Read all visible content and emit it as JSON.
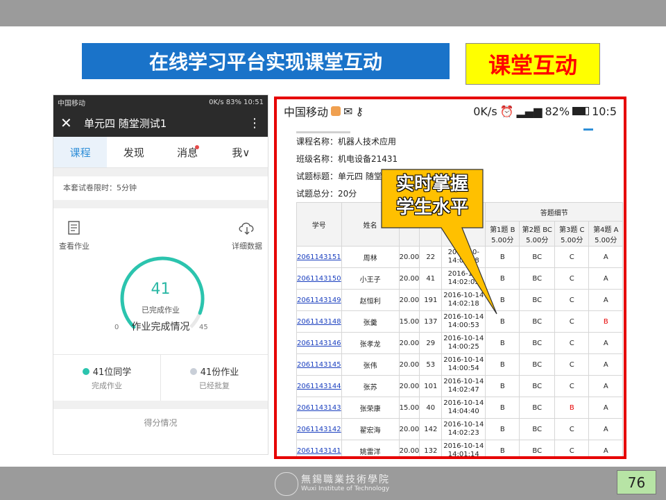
{
  "slide": {
    "title": "在线学习平台实现课堂互动",
    "tag": "课堂互动",
    "page_number": "76",
    "footer_cn": "無錫職業技術學院",
    "footer_en": "Wuxi Institute of Technology"
  },
  "left_phone": {
    "status_left": "中国移动",
    "status_right": "0K/s 83% 10:51",
    "nav_title": "单元四 随堂测试1",
    "tabs": [
      {
        "label": "课程",
        "active": true
      },
      {
        "label": "发现",
        "active": false
      },
      {
        "label": "消息",
        "active": false,
        "badge": true
      },
      {
        "label": "我∨",
        "active": false
      }
    ],
    "time_limit": "本套试卷限时：5分钟",
    "view_homework": "查看作业",
    "detail_data": "详细数据",
    "gauge": {
      "value": "41",
      "label": "已完成作业",
      "caption": "作业完成情况",
      "min": "0",
      "max": "45",
      "fraction": 0.911
    },
    "stats": [
      {
        "big": "41位同学",
        "small": "完成作业",
        "color": "#2bc4ae"
      },
      {
        "big": "41份作业",
        "small": "已经批复",
        "color": "#c9cfd8"
      }
    ],
    "score_label": "得分情况"
  },
  "right_shot": {
    "status_left": "中国移动",
    "status_right": "0K/s",
    "battery": "82%",
    "time": "10:5",
    "course_name": "课程名称：机器人技术应用",
    "class_name": "班级名称：机电设备21431",
    "test_title": "试题标题：单元四 随堂",
    "total_score": "试题总分：20分",
    "headers": {
      "sid": "学号",
      "name": "姓名",
      "detail": "答题细节",
      "q1": "第1题 B",
      "q1s": "5.00分",
      "q2": "第2题 BC",
      "q2s": "5.00分",
      "q3": "第3题 C",
      "q3s": "5.00分",
      "q4": "第4题 A",
      "q4s": "5.00分"
    },
    "rows": [
      {
        "sid": "2061143151",
        "name": "周林",
        "score": "20.00",
        "sec": "22",
        "d": "2016-10-",
        "t": "14:02:08",
        "a1": "B",
        "a2": "BC",
        "a3": "C",
        "a4": "A"
      },
      {
        "sid": "2061143150",
        "name": "小王子",
        "score": "20.00",
        "sec": "41",
        "d": "2016-10-",
        "t": "14:02:05",
        "a1": "B",
        "a2": "BC",
        "a3": "C",
        "a4": "A"
      },
      {
        "sid": "2061143149",
        "name": "赵恒利",
        "score": "20.00",
        "sec": "191",
        "d": "2016-10-14",
        "t": "14:02:18",
        "a1": "B",
        "a2": "BC",
        "a3": "C",
        "a4": "A"
      },
      {
        "sid": "2061143148",
        "name": "张羹",
        "score": "15.00",
        "sec": "137",
        "d": "2016-10-14",
        "t": "14:00:53",
        "a1": "B",
        "a2": "BC",
        "a3": "C",
        "a4": "B",
        "a4red": true
      },
      {
        "sid": "2061143146",
        "name": "张孝龙",
        "score": "20.00",
        "sec": "29",
        "d": "2016-10-14",
        "t": "14:00:25",
        "a1": "B",
        "a2": "BC",
        "a3": "C",
        "a4": "A"
      },
      {
        "sid": "2061143145",
        "name": "张伟",
        "score": "20.00",
        "sec": "53",
        "d": "2016-10-14",
        "t": "14:00:54",
        "a1": "B",
        "a2": "BC",
        "a3": "C",
        "a4": "A"
      },
      {
        "sid": "2061143144",
        "name": "张苏",
        "score": "20.00",
        "sec": "101",
        "d": "2016-10-14",
        "t": "14:02:47",
        "a1": "B",
        "a2": "BC",
        "a3": "C",
        "a4": "A"
      },
      {
        "sid": "2061143143",
        "name": "张荣康",
        "score": "15.00",
        "sec": "40",
        "d": "2016-10-14",
        "t": "14:04:40",
        "a1": "B",
        "a2": "BC",
        "a3": "B",
        "a3red": true,
        "a4": "A"
      },
      {
        "sid": "2061143142",
        "name": "翟宏海",
        "score": "20.00",
        "sec": "142",
        "d": "2016-10-14",
        "t": "14:02:23",
        "a1": "B",
        "a2": "BC",
        "a3": "C",
        "a4": "A"
      },
      {
        "sid": "2061143141",
        "name": "姚雷洋",
        "score": "20.00",
        "sec": "132",
        "d": "2016-10-14",
        "t": "14:01:14",
        "a1": "B",
        "a2": "BC",
        "a3": "C",
        "a4": "A"
      }
    ]
  },
  "callout": {
    "line1": "实时掌握",
    "line2": "学生水平"
  }
}
